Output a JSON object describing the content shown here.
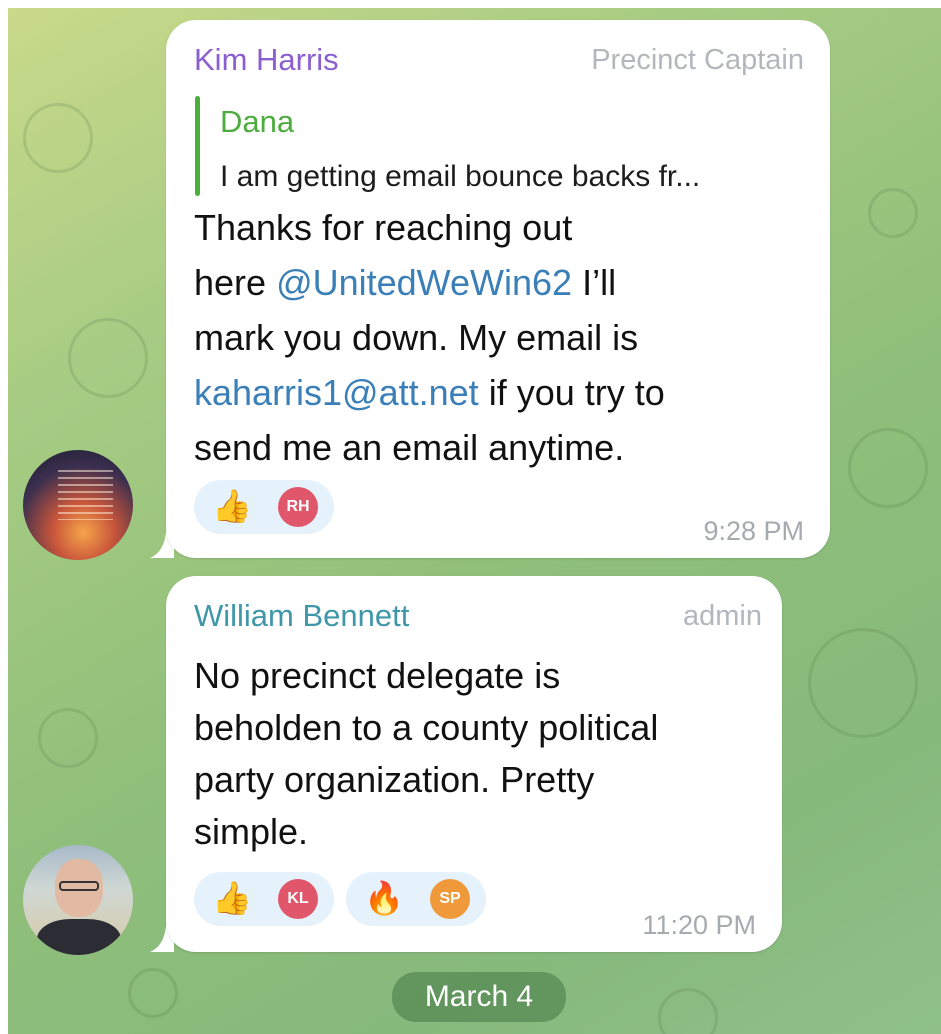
{
  "messages": [
    {
      "sender": "Kim Harris",
      "role": "Precinct Captain",
      "sender_color": "#8b5fd0",
      "reply": {
        "name": "Dana",
        "text": "I am getting email bounce backs fr..."
      },
      "lines": [
        [
          "Thanks for reaching out"
        ],
        [
          "here ",
          "@UnitedWeWin62",
          "  I’ll"
        ],
        [
          "mark you down. My email is"
        ],
        [
          "kaharris1@att.net",
          " if you try to"
        ],
        [
          "send me an email anytime."
        ]
      ],
      "reactions": [
        {
          "emoji": "👍",
          "emoji_name": "thumbs-up",
          "user": "RH",
          "user_color": "#e0566b"
        }
      ],
      "time": "9:28 PM",
      "avatar": "quote-sunset-avatar"
    },
    {
      "sender": "William Bennett",
      "role": "admin",
      "sender_color": "#3f97a8",
      "lines": [
        [
          "No precinct delegate is"
        ],
        [
          "beholden to a county political"
        ],
        [
          "party organization. Pretty"
        ],
        [
          "simple."
        ]
      ],
      "reactions": [
        {
          "emoji": "👍",
          "emoji_name": "thumbs-up",
          "user": "KL",
          "user_color": "#e0566b"
        },
        {
          "emoji": "🔥",
          "emoji_name": "fire",
          "user": "SP",
          "user_color": "#f0993a"
        }
      ],
      "time": "11:20 PM",
      "avatar": "man-portrait-avatar"
    }
  ],
  "date_separator": "March 4",
  "colors": {
    "link": "#3b7fb8",
    "quote_accent": "#4cad3e",
    "reaction_bg": "#e5f1fb"
  }
}
